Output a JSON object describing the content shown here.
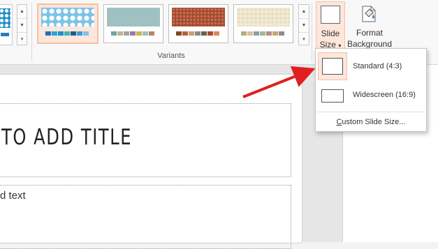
{
  "ribbon": {
    "variants_group_label": "Variants",
    "variants": [
      {
        "name": "variant-1",
        "top": "#2a8fcd",
        "bar": [
          "#2b6cb0",
          "#23a7d8",
          "#1f8fc6",
          "#41b5b0",
          "#1b5f8e",
          "#3e9bd6",
          "#7cc3e8"
        ]
      },
      {
        "name": "variant-2",
        "top": "#9fc1c1",
        "bar": [
          "#6fa4a4",
          "#c2b38f",
          "#a2a2a2",
          "#8e7fa1",
          "#d1b14c",
          "#9fc1c1",
          "#b48862"
        ]
      },
      {
        "name": "variant-3",
        "top": "#a84a2e",
        "bar": [
          "#7d4a2e",
          "#b5623c",
          "#c9a070",
          "#8a8a8a",
          "#6f5e4e",
          "#a84a2e",
          "#d98a54"
        ]
      },
      {
        "name": "variant-4",
        "top": "#f2ead4",
        "bar": [
          "#b7a987",
          "#d9c48c",
          "#8c9ab7",
          "#a1b88c",
          "#b98c8c",
          "#c9a56b",
          "#8c8c8c"
        ]
      }
    ],
    "slide_size": {
      "label_line1": "Slide",
      "label_line2": "Size",
      "caret": "▾"
    },
    "format_background": {
      "label_line1": "Format",
      "label_line2": "Background"
    }
  },
  "slide": {
    "title_placeholder": "TO ADD TITLE",
    "body_placeholder": "d text"
  },
  "dropdown": {
    "standard": "Standard (4:3)",
    "widescreen": "Widescreen (16:9)",
    "custom_pre": "",
    "custom_underlined": "C",
    "custom_post": "ustom Slide Size..."
  },
  "colors": {
    "highlight_bg": "#fde6da",
    "highlight_border": "#f2c2a6",
    "annotation_arrow": "#e02020"
  },
  "annotation": {
    "type": "arrow",
    "points_to": "Standard (4:3)"
  }
}
